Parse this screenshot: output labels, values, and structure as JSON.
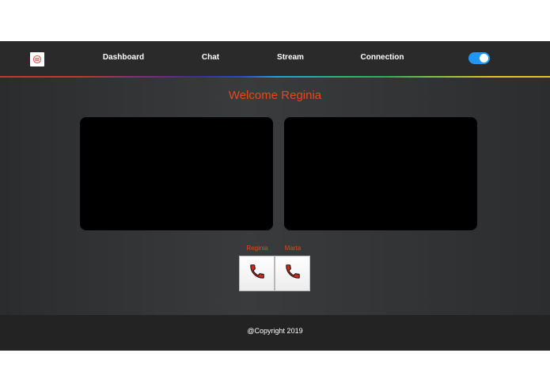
{
  "nav": {
    "logo": "logo-icon",
    "links": [
      "Dashboard",
      "Chat",
      "Stream",
      "Connection"
    ],
    "toggle_on": true,
    "accent": "#2196f3"
  },
  "main": {
    "welcome": "Welcome Reginia",
    "accent": "#e8461e"
  },
  "callers": [
    {
      "name": "Reginia",
      "icon": "phone-icon"
    },
    {
      "name": "Marta",
      "icon": "phone-icon"
    }
  ],
  "footer": {
    "copyright": "@Copyright 2019"
  }
}
